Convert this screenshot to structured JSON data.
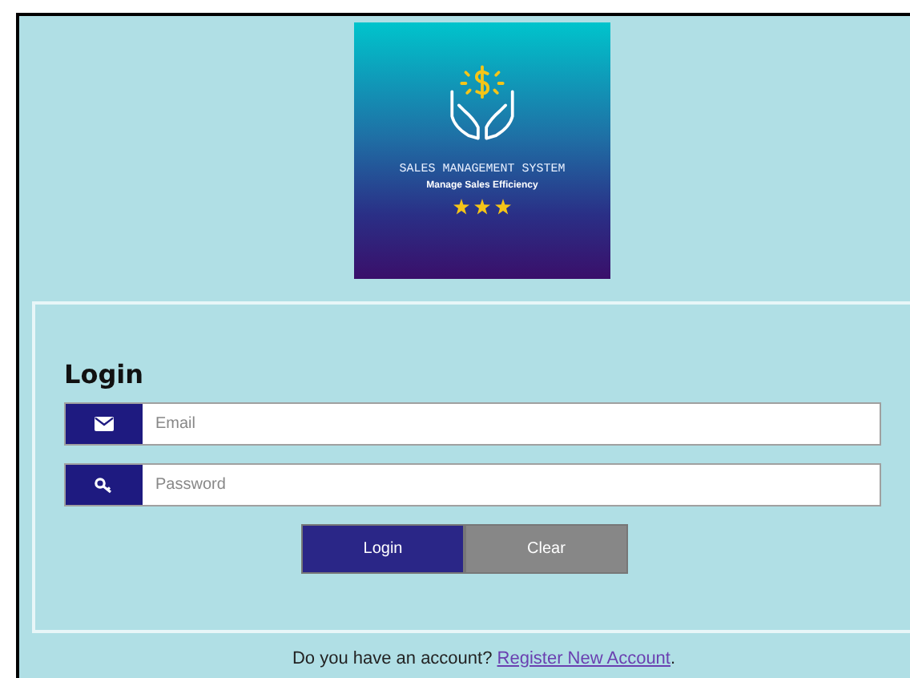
{
  "logo": {
    "title": "SALES MANAGEMENT SYSTEM",
    "tagline": "Manage Sales Efficiency"
  },
  "login": {
    "heading": "Login",
    "fields": [
      {
        "kind": "email",
        "placeholder": "Email"
      },
      {
        "kind": "password",
        "placeholder": "Password"
      }
    ],
    "buttons": [
      {
        "kind": "primary",
        "label": "Login"
      },
      {
        "kind": "secondary",
        "label": "Clear"
      }
    ]
  },
  "footer": {
    "text": "Do you have an account?",
    "link": "Register New Account",
    "tail": "."
  }
}
